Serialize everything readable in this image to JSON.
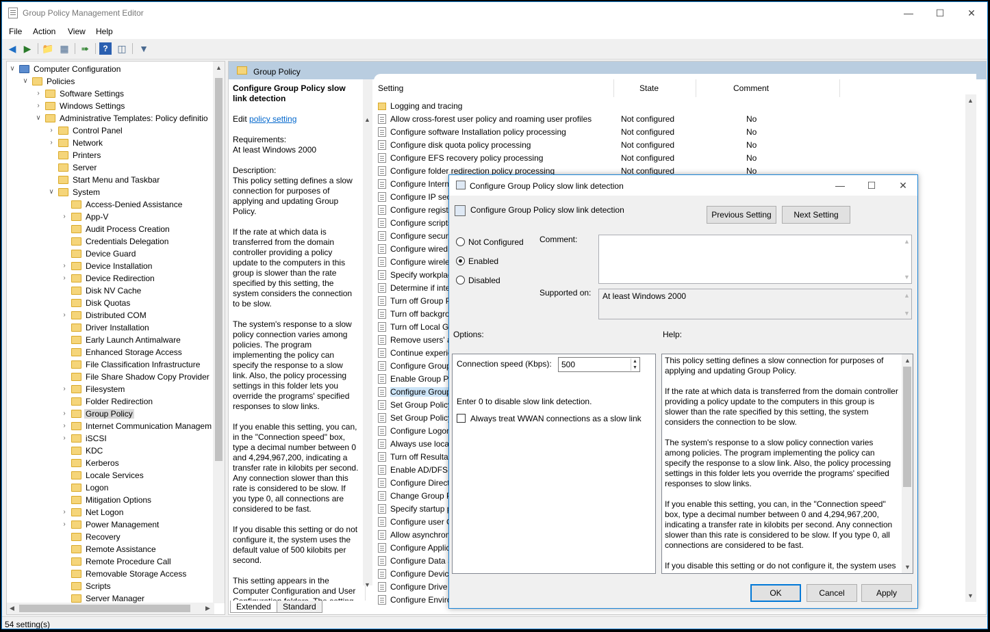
{
  "window": {
    "title": "Group Policy Management Editor"
  },
  "menu": [
    "File",
    "Action",
    "View",
    "Help"
  ],
  "tree": {
    "items": [
      {
        "label": "Computer Configuration",
        "level": 0,
        "exp": "open"
      },
      {
        "label": "Policies",
        "level": 1,
        "exp": "open"
      },
      {
        "label": "Software Settings",
        "level": 2,
        "exp": "closed"
      },
      {
        "label": "Windows Settings",
        "level": 2,
        "exp": "closed"
      },
      {
        "label": "Administrative Templates: Policy definitio",
        "level": 2,
        "exp": "open"
      },
      {
        "label": "Control Panel",
        "level": 3,
        "exp": "closed"
      },
      {
        "label": "Network",
        "level": 3,
        "exp": "closed"
      },
      {
        "label": "Printers",
        "level": 3,
        "exp": "none"
      },
      {
        "label": "Server",
        "level": 3,
        "exp": "none"
      },
      {
        "label": "Start Menu and Taskbar",
        "level": 3,
        "exp": "none"
      },
      {
        "label": "System",
        "level": 3,
        "exp": "open"
      },
      {
        "label": "Access-Denied Assistance",
        "level": 4,
        "exp": "none"
      },
      {
        "label": "App-V",
        "level": 4,
        "exp": "closed"
      },
      {
        "label": "Audit Process Creation",
        "level": 4,
        "exp": "none"
      },
      {
        "label": "Credentials Delegation",
        "level": 4,
        "exp": "none"
      },
      {
        "label": "Device Guard",
        "level": 4,
        "exp": "none"
      },
      {
        "label": "Device Installation",
        "level": 4,
        "exp": "closed"
      },
      {
        "label": "Device Redirection",
        "level": 4,
        "exp": "closed"
      },
      {
        "label": "Disk NV Cache",
        "level": 4,
        "exp": "none"
      },
      {
        "label": "Disk Quotas",
        "level": 4,
        "exp": "none"
      },
      {
        "label": "Distributed COM",
        "level": 4,
        "exp": "closed"
      },
      {
        "label": "Driver Installation",
        "level": 4,
        "exp": "none"
      },
      {
        "label": "Early Launch Antimalware",
        "level": 4,
        "exp": "none"
      },
      {
        "label": "Enhanced Storage Access",
        "level": 4,
        "exp": "none"
      },
      {
        "label": "File Classification Infrastructure",
        "level": 4,
        "exp": "none"
      },
      {
        "label": "File Share Shadow Copy Provider",
        "level": 4,
        "exp": "none"
      },
      {
        "label": "Filesystem",
        "level": 4,
        "exp": "closed"
      },
      {
        "label": "Folder Redirection",
        "level": 4,
        "exp": "none"
      },
      {
        "label": "Group Policy",
        "level": 4,
        "exp": "closed",
        "selected": true
      },
      {
        "label": "Internet Communication Managem",
        "level": 4,
        "exp": "closed"
      },
      {
        "label": "iSCSI",
        "level": 4,
        "exp": "closed"
      },
      {
        "label": "KDC",
        "level": 4,
        "exp": "none"
      },
      {
        "label": "Kerberos",
        "level": 4,
        "exp": "none"
      },
      {
        "label": "Locale Services",
        "level": 4,
        "exp": "none"
      },
      {
        "label": "Logon",
        "level": 4,
        "exp": "none"
      },
      {
        "label": "Mitigation Options",
        "level": 4,
        "exp": "none"
      },
      {
        "label": "Net Logon",
        "level": 4,
        "exp": "closed"
      },
      {
        "label": "Power Management",
        "level": 4,
        "exp": "closed"
      },
      {
        "label": "Recovery",
        "level": 4,
        "exp": "none"
      },
      {
        "label": "Remote Assistance",
        "level": 4,
        "exp": "none"
      },
      {
        "label": "Remote Procedure Call",
        "level": 4,
        "exp": "none"
      },
      {
        "label": "Removable Storage Access",
        "level": 4,
        "exp": "none"
      },
      {
        "label": "Scripts",
        "level": 4,
        "exp": "none"
      },
      {
        "label": "Server Manager",
        "level": 4,
        "exp": "none"
      }
    ]
  },
  "header": {
    "title": "Group Policy"
  },
  "desc": {
    "title": "Configure Group Policy slow link detection",
    "edit_prefix": "Edit ",
    "edit_link": "policy setting ",
    "req_label": "Requirements:",
    "req_value": "At least Windows 2000",
    "desc_label": "Description:",
    "p1": "This policy setting defines a slow connection for purposes of applying and updating Group Policy.",
    "p2": "If the rate at which data is transferred from the domain controller providing a policy update to the computers in this group is slower than the rate specified by this setting, the system considers the connection to be slow.",
    "p3": "The system's response to a slow policy connection varies among policies. The program implementing the policy can specify the response to a slow link. Also, the policy processing settings in this folder lets you override the programs' specified responses to slow links.",
    "p4": "If you enable this setting, you can, in the \"Connection speed\" box, type a decimal number between 0 and 4,294,967,200, indicating a transfer rate in kilobits per second. Any connection slower than this rate is considered to be slow. If you type 0, all connections are considered to be fast.",
    "p5": "If you disable this setting or do not configure it, the system uses the default value of 500 kilobits per second.",
    "p6": "This setting appears in the Computer Configuration and User Configuration folders. The setting"
  },
  "list": {
    "col_setting": "Setting",
    "col_state": "State",
    "col_comment": "Comment",
    "rows": [
      {
        "name": "Logging and tracing",
        "state": "",
        "comment": "",
        "folder": true
      },
      {
        "name": "Allow cross-forest user policy and roaming user profiles",
        "state": "Not configured",
        "comment": "No"
      },
      {
        "name": "Configure software Installation policy processing",
        "state": "Not configured",
        "comment": "No"
      },
      {
        "name": "Configure disk quota policy processing",
        "state": "Not configured",
        "comment": "No"
      },
      {
        "name": "Configure EFS recovery policy processing",
        "state": "Not configured",
        "comment": "No"
      },
      {
        "name": "Configure folder redirection policy processing",
        "state": "Not configured",
        "comment": "No"
      },
      {
        "name": "Configure Interne",
        "state": "",
        "comment": ""
      },
      {
        "name": "Configure IP secu",
        "state": "",
        "comment": ""
      },
      {
        "name": "Configure registr",
        "state": "",
        "comment": ""
      },
      {
        "name": "Configure scripts",
        "state": "",
        "comment": ""
      },
      {
        "name": "Configure securit",
        "state": "",
        "comment": ""
      },
      {
        "name": "Configure wired p",
        "state": "",
        "comment": ""
      },
      {
        "name": "Configure wireles",
        "state": "",
        "comment": ""
      },
      {
        "name": "Specify workplac",
        "state": "",
        "comment": ""
      },
      {
        "name": "Determine if inter",
        "state": "",
        "comment": ""
      },
      {
        "name": "Turn off Group P",
        "state": "",
        "comment": ""
      },
      {
        "name": "Turn off backgro",
        "state": "",
        "comment": ""
      },
      {
        "name": "Turn off Local Gr",
        "state": "",
        "comment": ""
      },
      {
        "name": "Remove users' ab",
        "state": "",
        "comment": ""
      },
      {
        "name": "Continue experie",
        "state": "",
        "comment": ""
      },
      {
        "name": "Configure Group",
        "state": "",
        "comment": ""
      },
      {
        "name": "Enable Group Pol",
        "state": "",
        "comment": ""
      },
      {
        "name": "Configure Group",
        "state": "",
        "comment": "",
        "selected": true
      },
      {
        "name": "Set Group Policy",
        "state": "",
        "comment": ""
      },
      {
        "name": "Set Group Policy",
        "state": "",
        "comment": ""
      },
      {
        "name": "Configure Logon",
        "state": "",
        "comment": ""
      },
      {
        "name": "Always use local",
        "state": "",
        "comment": ""
      },
      {
        "name": "Turn off Resultan",
        "state": "",
        "comment": ""
      },
      {
        "name": "Enable AD/DFS d",
        "state": "",
        "comment": ""
      },
      {
        "name": "Configure Direct",
        "state": "",
        "comment": ""
      },
      {
        "name": "Change Group Po",
        "state": "",
        "comment": ""
      },
      {
        "name": "Specify startup p",
        "state": "",
        "comment": ""
      },
      {
        "name": "Configure user G",
        "state": "",
        "comment": ""
      },
      {
        "name": "Allow asynchron",
        "state": "",
        "comment": ""
      },
      {
        "name": "Configure Applic",
        "state": "",
        "comment": ""
      },
      {
        "name": "Configure Data S",
        "state": "",
        "comment": ""
      },
      {
        "name": "Configure Device",
        "state": "",
        "comment": ""
      },
      {
        "name": "Configure Drive M",
        "state": "",
        "comment": ""
      },
      {
        "name": "Configure Enviro",
        "state": "",
        "comment": ""
      }
    ]
  },
  "tabs": [
    "Extended",
    "Standard"
  ],
  "status": "54 setting(s)",
  "dialog": {
    "title": "Configure Group Policy slow link detection",
    "subtitle": "Configure Group Policy slow link detection",
    "prev": "Previous Setting",
    "next": "Next Setting",
    "radio_nc": "Not Configured",
    "radio_en": "Enabled",
    "radio_dis": "Disabled",
    "comment_label": "Comment:",
    "supported_label": "Supported on:",
    "supported_value": "At least Windows 2000",
    "options_label": "Options:",
    "help_label": "Help:",
    "speed_label": "Connection speed (Kbps):",
    "speed_value": "500",
    "hint": "Enter 0 to disable slow link detection.",
    "wwan": "Always treat WWAN connections as a slow link",
    "help_p1": "This policy setting defines a slow connection for purposes of applying and updating Group Policy.",
    "help_p2": "If the rate at which data is transferred from the domain controller providing a policy update to the computers in this group is slower than the rate specified by this setting, the system considers the connection to be slow.",
    "help_p3": "The system's response to a slow policy connection varies among policies. The program implementing the policy can specify the response to a slow link. Also, the policy processing settings in this folder lets you override the programs' specified responses to slow links.",
    "help_p4": "If you enable this setting, you can, in the \"Connection speed\" box, type a decimal number between 0 and 4,294,967,200, indicating a transfer rate in kilobits per second. Any connection slower than this rate is considered to be slow. If you type 0, all connections are considered to be fast.",
    "help_p5": "If you disable this setting or do not configure it, the system uses",
    "ok": "OK",
    "cancel": "Cancel",
    "apply": "Apply"
  }
}
